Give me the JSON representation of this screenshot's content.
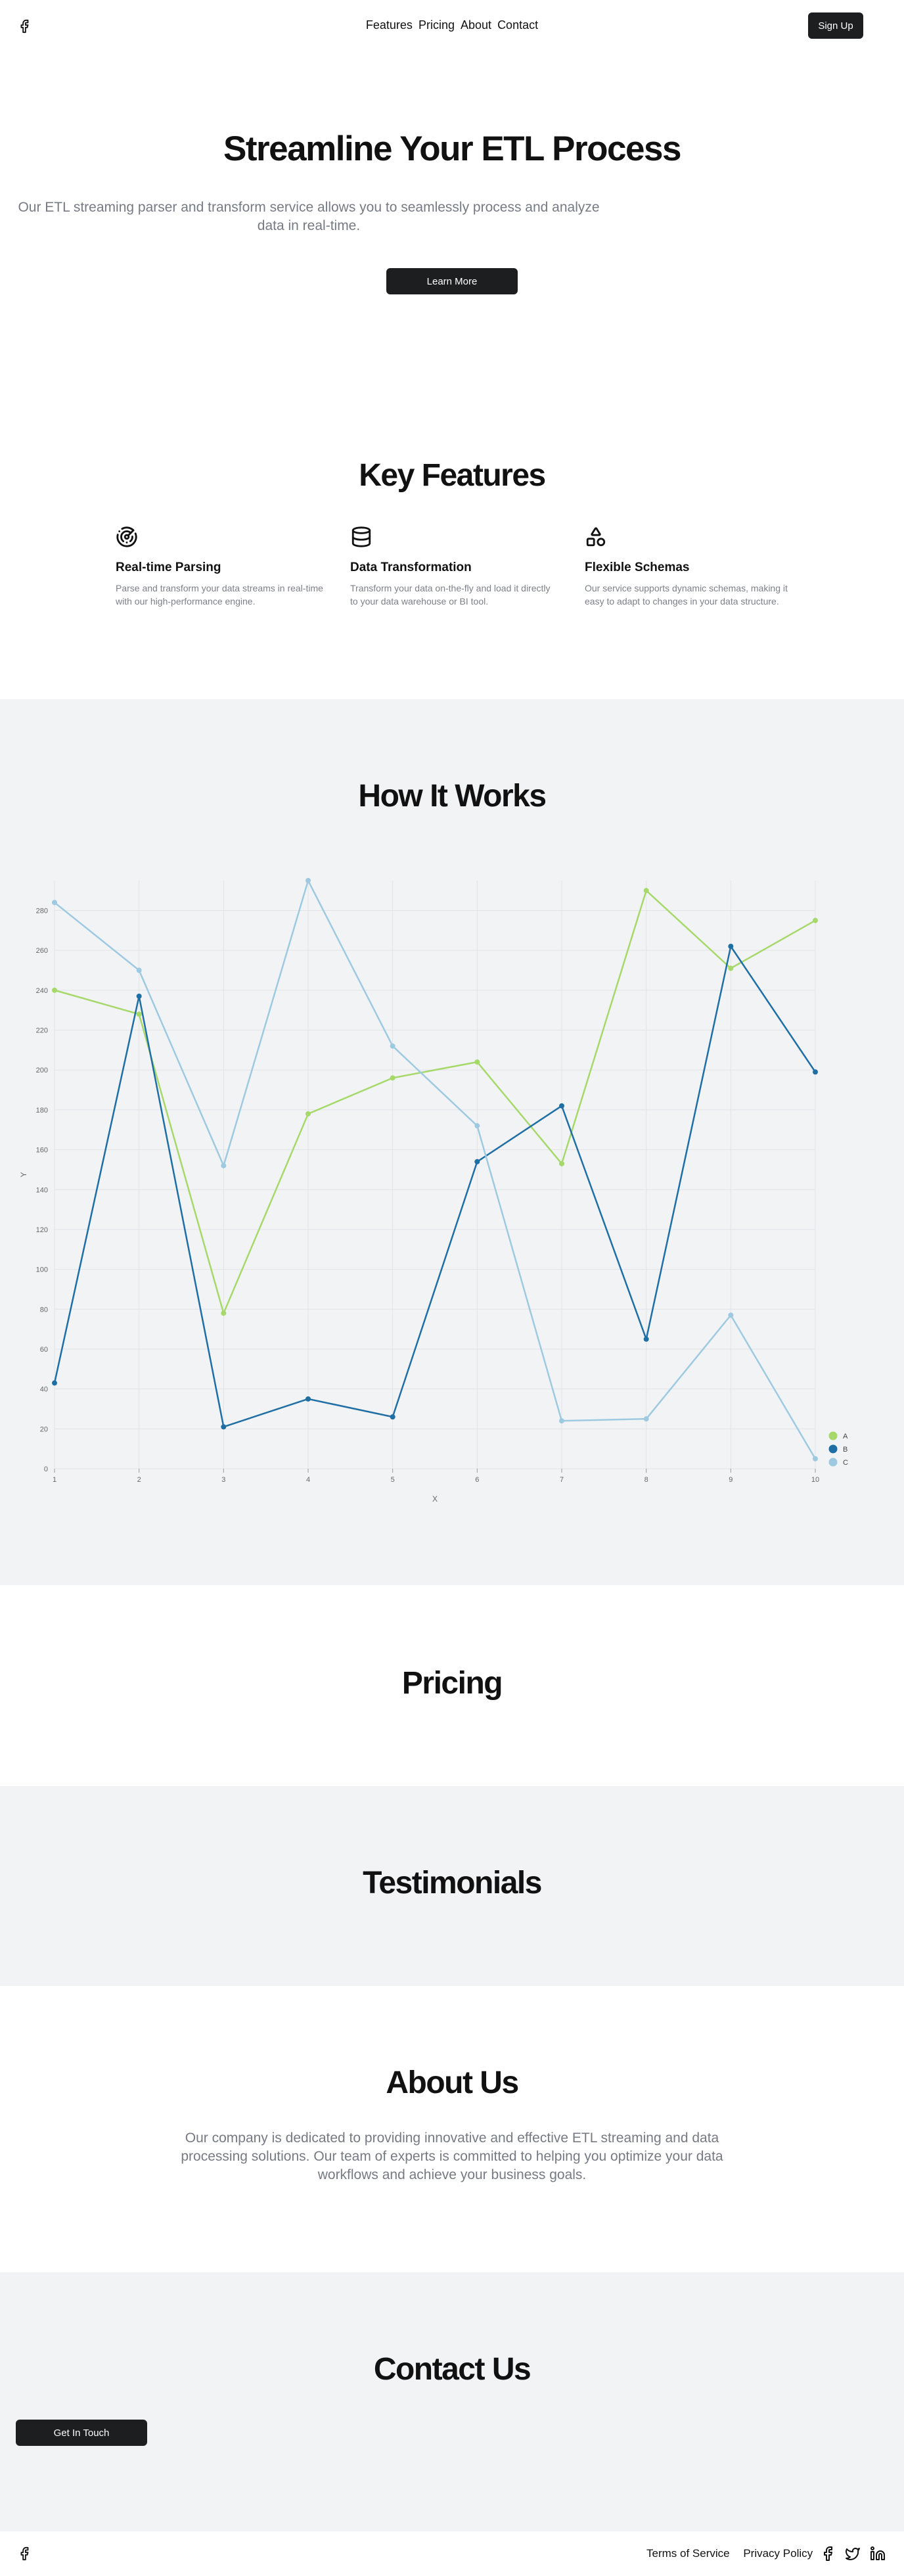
{
  "nav": {
    "logo_icon": "facebook-icon",
    "links": [
      "Features",
      "Pricing",
      "About",
      "Contact"
    ],
    "signup_label": "Sign Up"
  },
  "hero": {
    "title": "Streamline Your ETL Process",
    "subtitle": "Our ETL streaming parser and transform service allows you to seamlessly process and analyze data in real-time.",
    "cta_label": "Learn More"
  },
  "features": {
    "title": "Key Features",
    "items": [
      {
        "icon": "radar-icon",
        "title": "Real-time Parsing",
        "description": "Parse and transform your data streams in real-time with our high-performance engine."
      },
      {
        "icon": "database-icon",
        "title": "Data Transformation",
        "description": "Transform your data on-the-fly and load it directly to your data warehouse or BI tool."
      },
      {
        "icon": "shapes-icon",
        "title": "Flexible Schemas",
        "description": "Our service supports dynamic schemas, making it easy to adapt to changes in your data structure."
      }
    ]
  },
  "how_it_works": {
    "title": "How It Works"
  },
  "chart_data": {
    "type": "line",
    "x": [
      1,
      2,
      3,
      4,
      5,
      6,
      7,
      8,
      9,
      10
    ],
    "xlabel": "X",
    "ylabel": "Y",
    "xlim": [
      1,
      10
    ],
    "ylim": [
      0,
      295
    ],
    "y_ticks": [
      0,
      20,
      40,
      60,
      80,
      100,
      120,
      140,
      160,
      180,
      200,
      220,
      240,
      260,
      280
    ],
    "grid": true,
    "legend_position": "bottom-right",
    "series": [
      {
        "name": "A",
        "color": "#a6d96a",
        "values": [
          240,
          228,
          78,
          178,
          196,
          204,
          153,
          290,
          251,
          275
        ]
      },
      {
        "name": "B",
        "color": "#1f6fa5",
        "values": [
          43,
          237,
          21,
          35,
          26,
          154,
          182,
          65,
          262,
          199
        ]
      },
      {
        "name": "C",
        "color": "#9ecae1",
        "values": [
          284,
          250,
          152,
          295,
          212,
          172,
          24,
          25,
          77,
          5
        ]
      }
    ]
  },
  "pricing": {
    "title": "Pricing"
  },
  "testimonials": {
    "title": "Testimonials"
  },
  "about": {
    "title": "About Us",
    "text": "Our company is dedicated to providing innovative and effective ETL streaming and data processing solutions. Our team of experts is committed to helping you optimize your data workflows and achieve your business goals."
  },
  "contact": {
    "title": "Contact Us",
    "cta_label": "Get In Touch"
  },
  "footer": {
    "logo_icon": "facebook-icon",
    "links": [
      "Terms of Service",
      "Privacy Policy"
    ],
    "social_icons": [
      "facebook-icon",
      "twitter-icon",
      "linkedin-icon"
    ]
  }
}
